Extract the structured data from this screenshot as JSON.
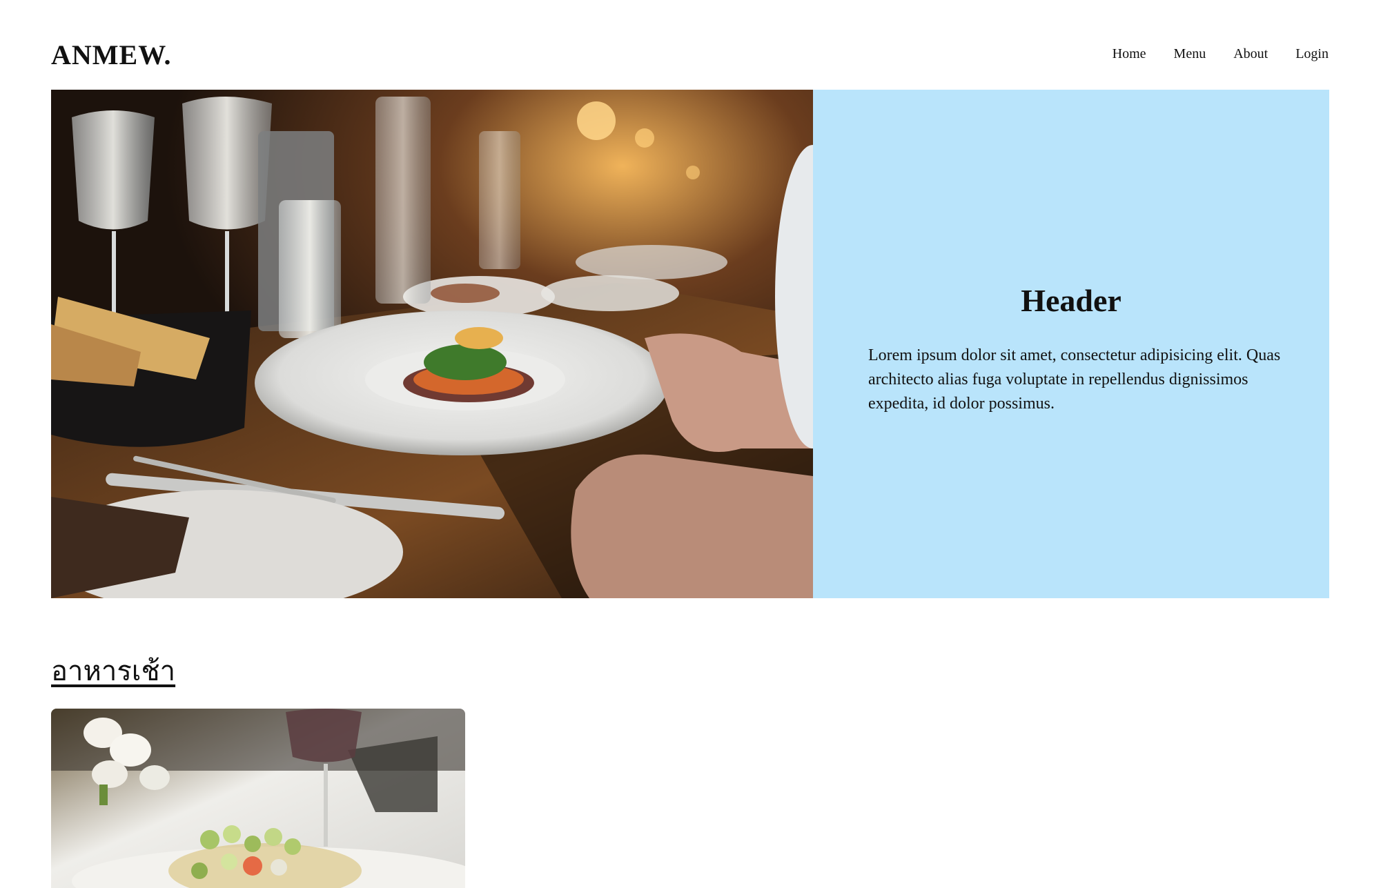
{
  "brand": "ANMEW.",
  "nav": [
    "Home",
    "Menu",
    "About",
    "Login"
  ],
  "hero": {
    "title": "Header",
    "text": "Lorem ipsum dolor sit amet, consectetur adipisicing elit. Quas architecto alias fuga voluptate in repellendus dignissimos expedita, id dolor possimus.",
    "panel_color": "#b9e4fb"
  },
  "section": {
    "title": "อาหารเช้า"
  }
}
